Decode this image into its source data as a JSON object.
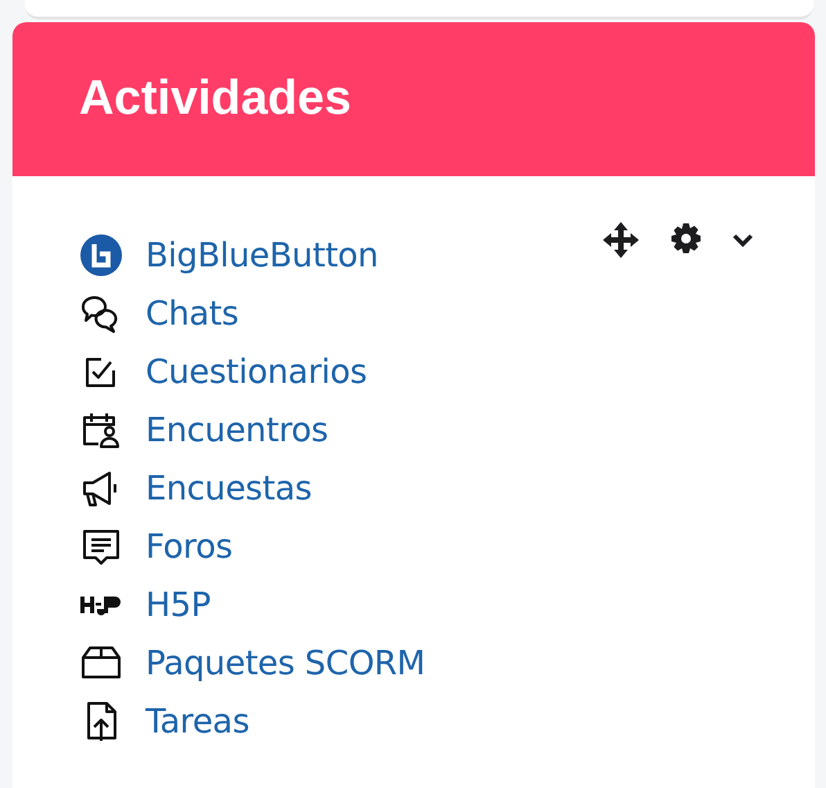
{
  "block": {
    "title": "Actividades"
  },
  "items": [
    {
      "label": "BigBlueButton"
    },
    {
      "label": "Chats"
    },
    {
      "label": "Cuestionarios"
    },
    {
      "label": "Encuentros"
    },
    {
      "label": "Encuestas"
    },
    {
      "label": "Foros"
    },
    {
      "label": "H5P"
    },
    {
      "label": "Paquetes SCORM"
    },
    {
      "label": "Tareas"
    }
  ]
}
